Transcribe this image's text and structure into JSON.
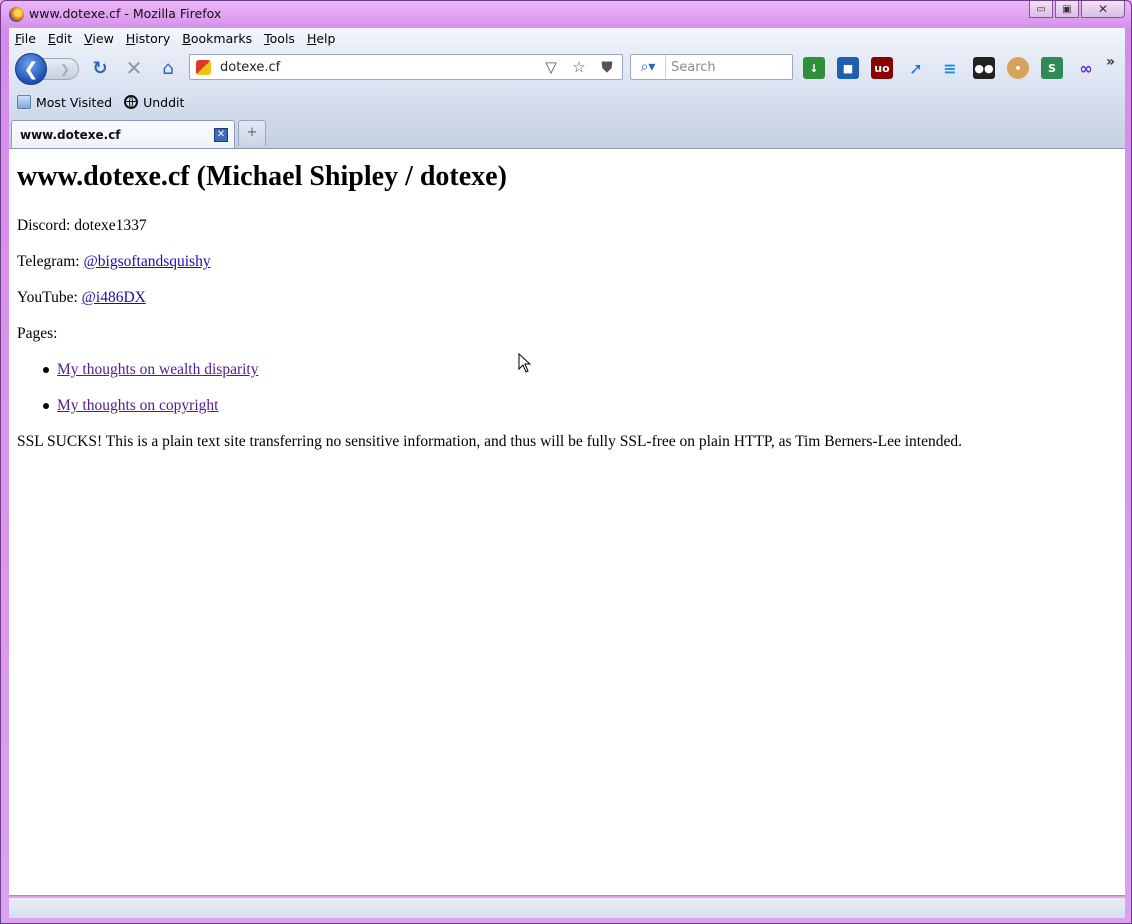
{
  "window": {
    "title": "www.dotexe.cf - Mozilla Firefox",
    "minimize": "▭",
    "maximize": "▣",
    "close": "✕"
  },
  "menubar": {
    "items": [
      {
        "label": "File",
        "accel": "F",
        "rest": "ile"
      },
      {
        "label": "Edit",
        "accel": "E",
        "rest": "dit"
      },
      {
        "label": "View",
        "accel": "V",
        "rest": "iew"
      },
      {
        "label": "History",
        "accel": "H",
        "rest": "istory"
      },
      {
        "label": "Bookmarks",
        "accel": "B",
        "rest": "ookmarks"
      },
      {
        "label": "Tools",
        "accel": "T",
        "rest": "ools"
      },
      {
        "label": "Help",
        "accel": "H",
        "rest": "elp"
      }
    ]
  },
  "navbar": {
    "url": "dotexe.cf",
    "search_placeholder": "Search"
  },
  "bookmarks": {
    "items": [
      "Most Visited",
      "Unddit"
    ]
  },
  "tabs": {
    "active_title": "www.dotexe.cf",
    "new_tab": "+"
  },
  "page": {
    "heading": "www.dotexe.cf (Michael Shipley / dotexe)",
    "discord_label": "Discord:",
    "discord_value": "dotexe1337",
    "telegram_label": "Telegram:",
    "telegram_link": "@bigsoftandsquishy",
    "youtube_label": "YouTube:",
    "youtube_link": "@i486DX",
    "pages_label": "Pages:",
    "pages": [
      "My thoughts on wealth disparity",
      "My thoughts on copyright"
    ],
    "ssl_note": "SSL SUCKS! This is a plain text site transferring no sensitive information, and thus will be fully SSL-free on plain HTTP, as Tim Berners-Lee intended."
  },
  "colors": {
    "link": "#1a0dab",
    "visited_link": "#551a8b",
    "frame": "#d891ee"
  },
  "icons": {
    "extensions": [
      "download-icon",
      "pocket-like-icon",
      "ublock-icon",
      "arrow-extension-icon",
      "lines-extension-icon",
      "tampermonkey-icon",
      "cookie-icon",
      "s-extension-icon",
      "link-extension-icon"
    ]
  }
}
